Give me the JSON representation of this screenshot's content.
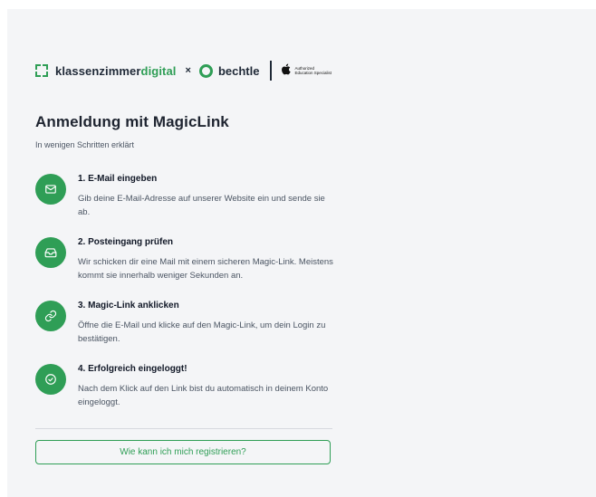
{
  "brand": {
    "kz_part1": "klassenzimmer",
    "kz_part2": "digital",
    "separator": "×",
    "partner": "bechtle",
    "apple_line1": "Authorized",
    "apple_line2": "Education Specialist"
  },
  "heading": {
    "title": "Anmeldung mit MagicLink",
    "subtitle": "In wenigen Schritten erklärt"
  },
  "steps": [
    {
      "icon": "mail-icon",
      "title": "1. E-Mail eingeben",
      "text": "Gib deine E-Mail-Adresse auf unserer Website ein und sende sie ab."
    },
    {
      "icon": "inbox-icon",
      "title": "2. Posteingang prüfen",
      "text": "Wir schicken dir eine Mail mit einem sicheren Magic-Link. Meistens kommt sie innerhalb weniger Sekunden an."
    },
    {
      "icon": "link-icon",
      "title": "3. Magic-Link anklicken",
      "text": "Öffne die E-Mail und klicke auf den Magic-Link, um dein Login zu bestätigen."
    },
    {
      "icon": "check-circle-icon",
      "title": "4. Erfolgreich eingeloggt!",
      "text": "Nach dem Klick auf den Link bist du automatisch in deinem Konto eingeloggt."
    }
  ],
  "actions": {
    "register_label": "Wie kann ich mich registrieren?"
  },
  "colors": {
    "accent": "#2f9e56",
    "background": "#f4f5f7"
  }
}
